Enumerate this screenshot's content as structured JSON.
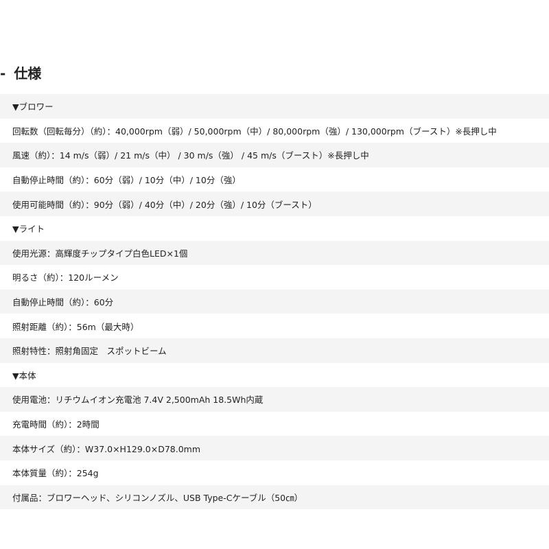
{
  "section": {
    "dash": "-",
    "title": "仕様"
  },
  "rows": [
    "▼ブロワー",
    "回転数（回転毎分）（約）：40,000rpm（弱）/ 50,000rpm（中）/ 80,000rpm（強）/ 130,000rpm（ブースト）※長押し中",
    "風速（約）：14 m/s（弱）/ 21 m/s（中） / 30 m/s（強） / 45 m/s（ブースト）※長押し中",
    "自動停止時間（約）：60分（弱）/ 10分（中）/ 10分（強）",
    "使用可能時間（約）：90分（弱）/ 40分（中）/ 20分（強）/ 10分（ブースト）",
    "▼ライト",
    "使用光源：高輝度チップタイプ白色LED×1個",
    "明るさ（約）：120ルーメン",
    "自動停止時間（約）：60分",
    "照射距離（約）：56m（最大時）",
    "照射特性：照射角固定　スポットビーム",
    "▼本体",
    "使用電池：リチウムイオン充電池 7.4V 2,500mAh 18.5Wh内蔵",
    "充電時間（約）：2時間",
    "本体サイズ（約）：W37.0×H129.0×D78.0mm",
    "本体質量（約）：254g",
    "付属品：ブロワーヘッド、シリコンノズル、USB Type-Cケーブル（50㎝）"
  ]
}
